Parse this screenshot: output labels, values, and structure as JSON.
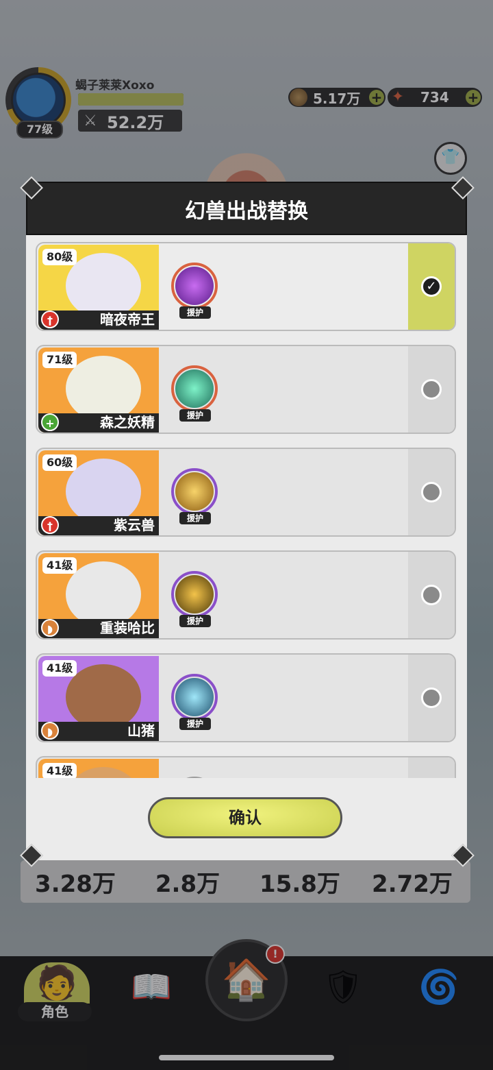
{
  "player": {
    "name": "蝎子莱莱Xoxo",
    "level": "77级",
    "power": "52.2万",
    "exp_fraction": 1.0
  },
  "currencies": [
    {
      "name": "gold-coin-icon",
      "value": "5.17万"
    },
    {
      "name": "star-gem-icon",
      "value": "734"
    }
  ],
  "modal": {
    "title": "幻兽出战替换",
    "confirm_label": "确认",
    "skill_tag": "援护"
  },
  "beasts": [
    {
      "level": "80级",
      "name": "暗夜帝王",
      "role": "attack-role-icon",
      "selected": true
    },
    {
      "level": "71级",
      "name": "森之妖精",
      "role": "heal-role-icon",
      "selected": false
    },
    {
      "level": "60级",
      "name": "紫云兽",
      "role": "attack-role-icon",
      "selected": false
    },
    {
      "level": "41级",
      "name": "重装哈比",
      "role": "defense-role-icon",
      "selected": false
    },
    {
      "level": "41级",
      "name": "山猪",
      "role": "defense-role-icon",
      "selected": false
    },
    {
      "level": "41级",
      "name": "",
      "role": "",
      "selected": false
    }
  ],
  "stats": [
    "3.28万",
    "2.8万",
    "15.8万",
    "2.72万"
  ],
  "nav": {
    "active_label": "角色"
  },
  "colors": {
    "accent": "#cfd462",
    "panel_dark": "#262626",
    "alert": "#d9342b"
  }
}
